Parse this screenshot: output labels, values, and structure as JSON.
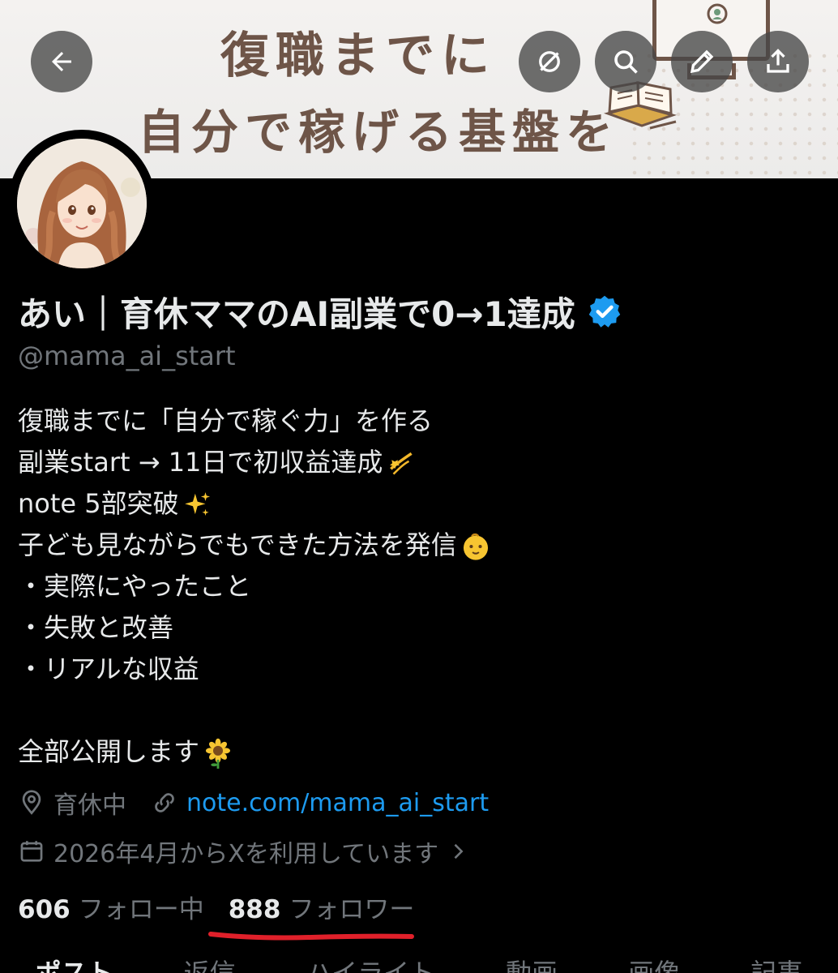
{
  "banner": {
    "line1": "復職までに",
    "line2": "自分で稼げる基盤を"
  },
  "header": {
    "back_icon": "arrow-left-icon",
    "actions": [
      "eye-off-icon",
      "search-icon",
      "pencil-icon",
      "share-icon"
    ]
  },
  "profile": {
    "name": "あい｜育休ママのAI副業で0→1達成",
    "handle": "@mama_ai_start",
    "verified": true,
    "bio": [
      "復職までに「自分で稼ぐ力」を作る",
      "副業start → 11日で初収益達成",
      "note 5部突破",
      "子ども見ながらでもできた方法を発信",
      "・実際にやったこと",
      "・失敗と改善",
      "・リアルな収益",
      "",
      "全部公開します"
    ],
    "location": "育休中",
    "website": "note.com/mama_ai_start",
    "joined": "2026年4月からXを利用しています",
    "following_count": "606",
    "following_label": "フォロー中",
    "followers_count": "888",
    "followers_label": "フォロワー"
  },
  "tabs": [
    "ポスト",
    "返信",
    "ハイライト",
    "動画",
    "画像",
    "記事"
  ],
  "colors": {
    "background": "#000000",
    "text": "#e7e9ea",
    "muted": "#71767b",
    "link": "#1d9bf0",
    "verified": "#1d9bf0",
    "annotation": "#e0202a"
  }
}
